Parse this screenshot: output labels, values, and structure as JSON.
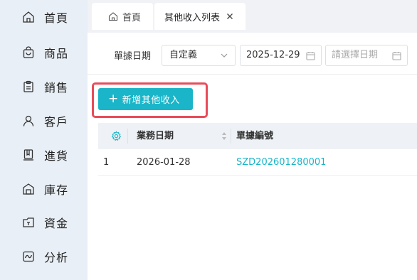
{
  "sidebar": {
    "items": [
      {
        "label": "首頁",
        "icon": "home-icon"
      },
      {
        "label": "商品",
        "icon": "bag-icon"
      },
      {
        "label": "銷售",
        "icon": "clipboard-icon"
      },
      {
        "label": "客戶",
        "icon": "person-icon"
      },
      {
        "label": "進貨",
        "icon": "book-icon"
      },
      {
        "label": "庫存",
        "icon": "warehouse-icon"
      },
      {
        "label": "資金",
        "icon": "wallet-icon"
      },
      {
        "label": "分析",
        "icon": "chart-icon"
      }
    ]
  },
  "tabs": {
    "home_label": "首頁",
    "active_label": "其他收入列表"
  },
  "filter": {
    "label": "單據日期",
    "mode": "自定義",
    "start_date": "2025-12-29",
    "end_placeholder": "請選擇日期"
  },
  "toolbar": {
    "add_label": "新增其他收入"
  },
  "table": {
    "columns": [
      "業務日期",
      "單據編號"
    ],
    "rows": [
      {
        "index": "1",
        "date": "2026-01-28",
        "doc_no": "SZD202601280001"
      }
    ]
  },
  "colors": {
    "accent": "#1ab5c8",
    "highlight": "#e84c5a",
    "sidebar_bg": "#e9eff6"
  }
}
